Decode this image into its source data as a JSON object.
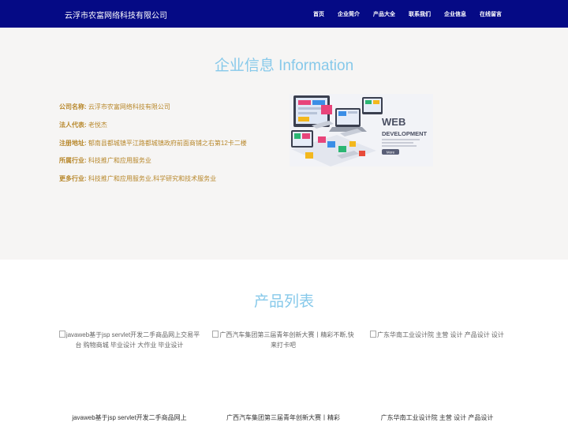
{
  "header": {
    "brand": "云浮市农富网络科技有限公司",
    "nav": [
      {
        "label": "首页"
      },
      {
        "label": "企业简介"
      },
      {
        "label": "产品大全"
      },
      {
        "label": "联系我们"
      },
      {
        "label": "企业信息"
      },
      {
        "label": "在线留言"
      }
    ]
  },
  "info": {
    "title": "企业信息 Information",
    "fields": [
      {
        "key": "公司名称:",
        "value": "云浮市农富网络科技有限公司"
      },
      {
        "key": "法人代表:",
        "value": "老悦杰"
      },
      {
        "key": "注册地址:",
        "value": "郁南县都城镇平江路都城镇政府前面商铺之右第12卡二楼"
      },
      {
        "key": "所属行业:",
        "value": "科技推广和应用服务业"
      },
      {
        "key": "更多行业:",
        "value": "科技推广和应用服务业,科学研究和技术服务业"
      }
    ],
    "illustration": {
      "line1": "WEB",
      "line2": "DEVELOPMENT",
      "button": "More"
    }
  },
  "products": {
    "title": "产品列表",
    "items": [
      {
        "alt": "javaweb基于jsp servlet开发二手商品网上交易平台 购物商城 毕业设计 大作业 毕业设计",
        "caption": "javaweb基于jsp servlet开发二手商品网上"
      },
      {
        "alt": "广西汽车集团第三届青年创新大赛丨精彩不断,快来打卡吧",
        "caption": "广西汽车集团第三届青年创新大赛丨精彩"
      },
      {
        "alt": "广东华南工业设计院 主营 设计 产品设计 设计",
        "caption": "广东华南工业设计院 主营 设计 产品设计"
      }
    ]
  }
}
